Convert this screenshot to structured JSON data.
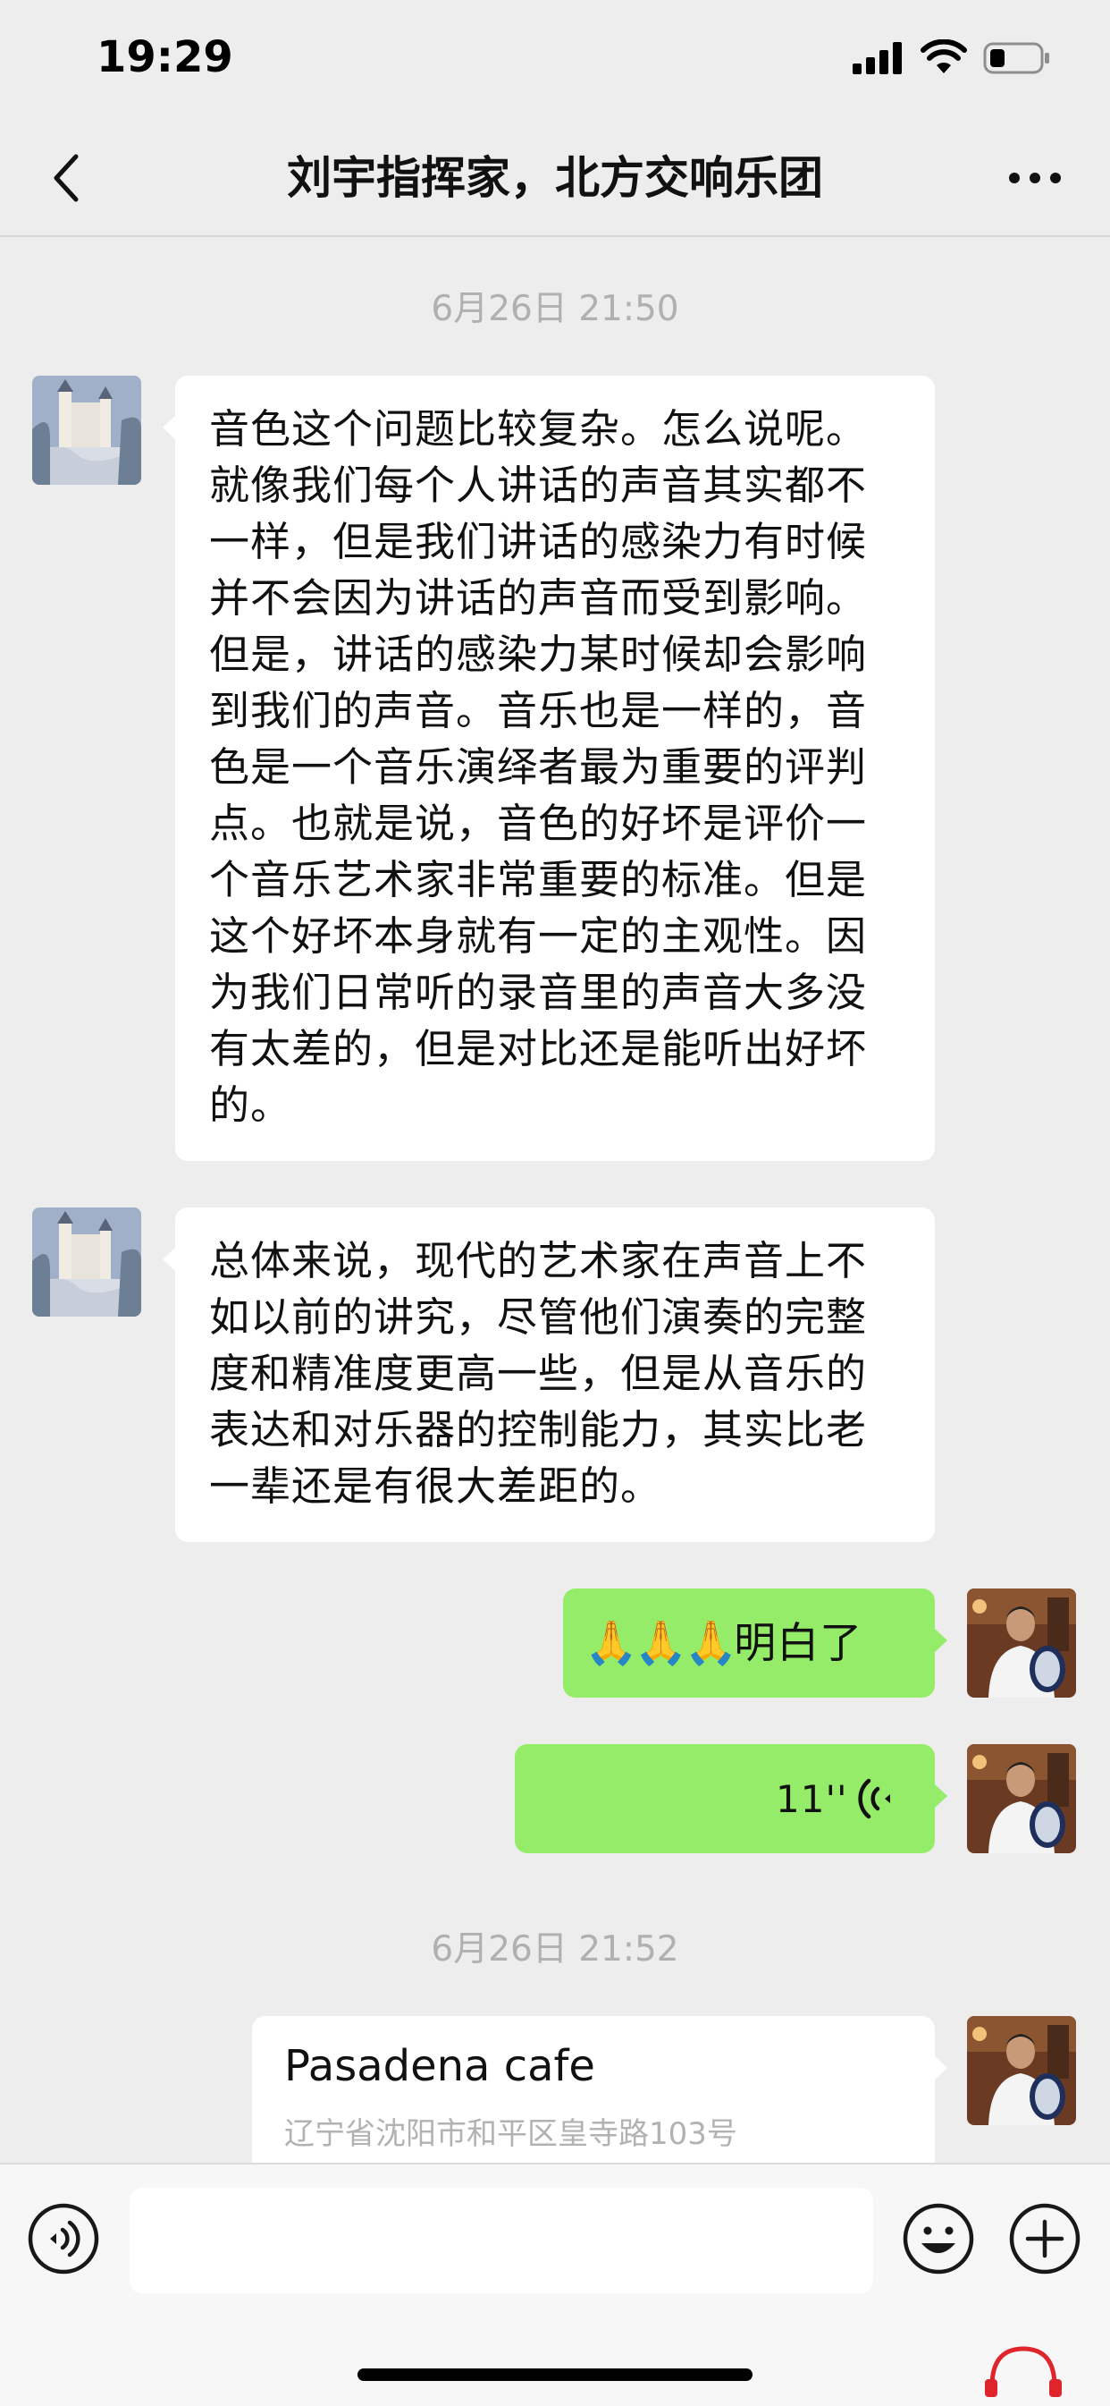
{
  "status_bar": {
    "time": "19:29"
  },
  "header": {
    "title": "刘宇指挥家，北方交响乐团",
    "back_icon": "chevron-left-icon",
    "more_icon": "more-dots-icon"
  },
  "messages": {
    "time_1": "6月26日 21:50",
    "msg_1": "音色这个问题比较复杂。怎么说呢。就像我们每个人讲话的声音其实都不一样，但是我们讲话的感染力有时候并不会因为讲话的声音而受到影响。但是，讲话的感染力某时候却会影响到我们的声音。音乐也是一样的，音色是一个音乐演绎者最为重要的评判点。也就是说，音色的好坏是评价一个音乐艺术家非常重要的标准。但是这个好坏本身就有一定的主观性。因为我们日常听的录音里的声音大多没有太差的，但是对比还是能听出好坏的。",
    "msg_2": "总体来说，现代的艺术家在声音上不如以前的讲究，尽管他们演奏的完整度和精准度更高一些，但是从音乐的表达和对乐器的控制能力，其实比老一辈还是有很大差距的。",
    "msg_3_emoji": "🙏🙏🙏",
    "msg_3_text": "明白了",
    "voice_duration": "11''",
    "time_2": "6月26日 21:52",
    "location_name": "Pasadena cafe",
    "location_address": "辽宁省沈阳市和平区皇寺路103号"
  },
  "input_bar": {
    "placeholder": ""
  },
  "colors": {
    "background": "#ededed",
    "bubble_self": "#95ec69",
    "bubble_other": "#ffffff",
    "timestamp": "#b0b0b0"
  }
}
